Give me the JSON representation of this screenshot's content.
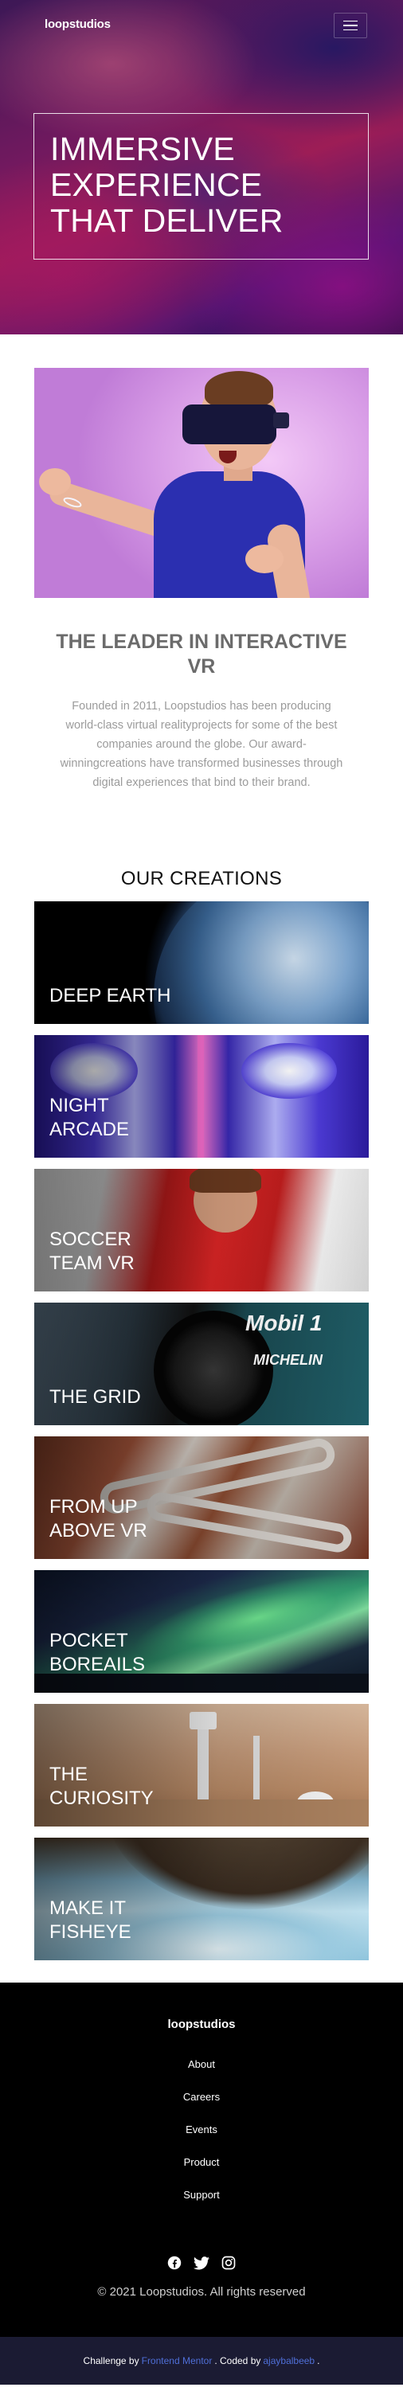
{
  "header": {
    "logo": "loopstudios",
    "menu_icon": "hamburger-menu-icon"
  },
  "hero": {
    "title": "IMMERSIVE EXPERIENCE THAT DELIVER"
  },
  "intro": {
    "title": "THE LEADER IN INTERACTIVE VR",
    "text": "Founded in 2011, Loopstudios has been producing world-class virtual realityprojects for some of the best companies around the globe. Our award-winningcreations have transformed businesses through digital experiences that bind to their brand."
  },
  "creations": {
    "title": "OUR CREATIONS",
    "items": [
      {
        "label": "DEEP EARTH"
      },
      {
        "label": "NIGHT ARCADE"
      },
      {
        "label": "SOCCER TEAM VR"
      },
      {
        "label": "THE GRID"
      },
      {
        "label": "FROM UP ABOVE VR"
      },
      {
        "label": "POCKET BOREAILS"
      },
      {
        "label": "THE CURIOSITY"
      },
      {
        "label": "MAKE IT FISHEYE"
      }
    ]
  },
  "footer": {
    "logo": "loopstudios",
    "nav": [
      "About",
      "Careers",
      "Events",
      "Product",
      "Support"
    ],
    "social_icons": [
      "facebook-icon",
      "twitter-icon",
      "instagram-icon"
    ],
    "copyright": "© 2021 Loopstudios. All rights reserved"
  },
  "attribution": {
    "prefix": "Challenge by",
    "challenge_link": "Frontend Mentor",
    "middle": ". Coded by",
    "author_link": "ajaybalbeeb",
    "suffix": "."
  },
  "colors": {
    "link": "#4f6fd8",
    "attribution_bg": "#1b1b33",
    "footer_bg": "#000000"
  }
}
